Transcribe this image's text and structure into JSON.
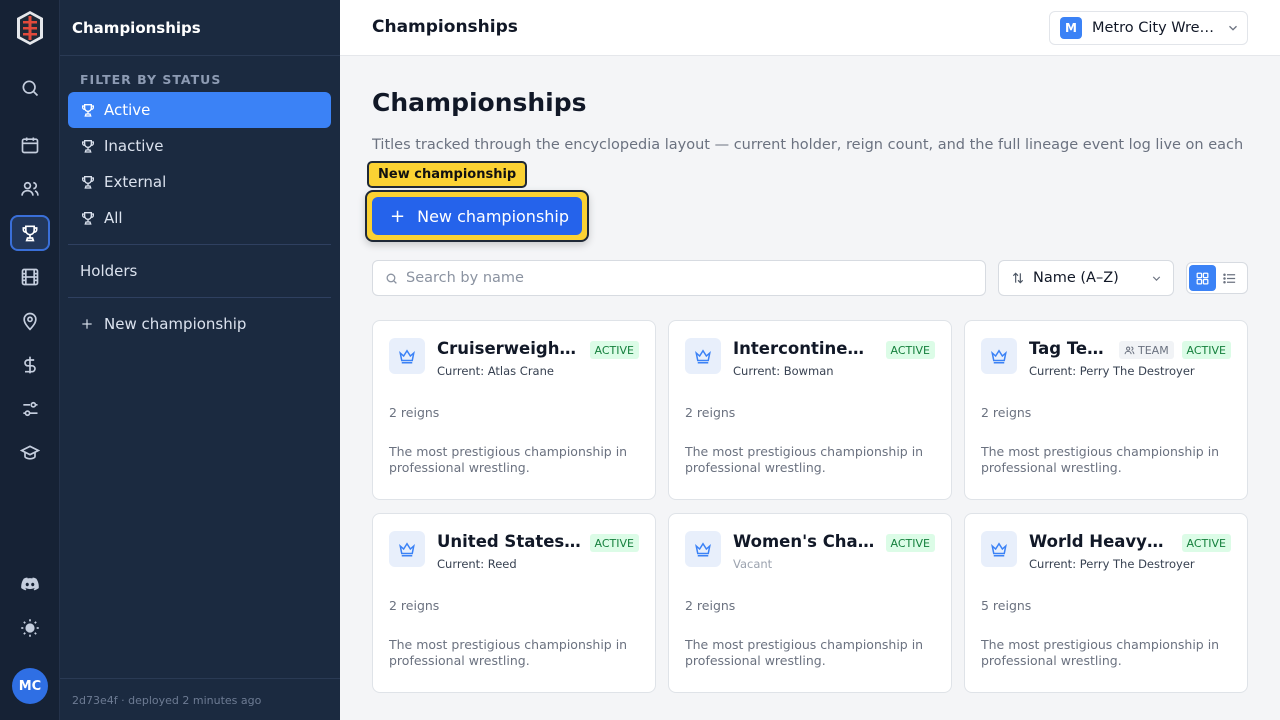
{
  "sidebar": {
    "title": "Championships",
    "filter_label": "FILTER BY STATUS",
    "filters": [
      {
        "label": "Active",
        "active": true
      },
      {
        "label": "Inactive",
        "active": false
      },
      {
        "label": "External",
        "active": false
      },
      {
        "label": "All",
        "active": false
      }
    ],
    "holders_label": "Holders",
    "new_label": "New championship",
    "deploy_hash": "2d73e4f",
    "deploy_text": "· deployed 2 minutes ago"
  },
  "rail": {
    "icons": [
      "search-icon",
      "calendar-icon",
      "users-icon",
      "trophy-icon",
      "film-icon",
      "map-pin-icon",
      "dollar-icon",
      "sliders-icon",
      "graduation-cap-icon",
      "discord-icon",
      "sun-icon"
    ],
    "active_icon": "trophy-icon",
    "avatar_initials": "MC"
  },
  "topbar": {
    "title": "Championships",
    "org_initial": "M",
    "org_name": "Metro City Wrestling"
  },
  "main": {
    "title": "Championships",
    "description": "Titles tracked through the encyclopedia layout — current holder, reign count, and the full lineage event log live on each",
    "tooltip": "New championship",
    "new_button_label": "New championship",
    "search_placeholder": "Search by name",
    "sort_label": "Name (A–Z)"
  },
  "cards": [
    {
      "name": "Cruiserweight Championship",
      "status": "ACTIVE",
      "team": false,
      "current": "Current: Atlas Crane",
      "vacant": false,
      "reigns": "2 reigns",
      "description": "The most prestigious championship in professional wrestling."
    },
    {
      "name": "Intercontinental Championship",
      "status": "ACTIVE",
      "team": false,
      "current": "Current: Bowman",
      "vacant": false,
      "reigns": "2 reigns",
      "description": "The most prestigious championship in professional wrestling."
    },
    {
      "name": "Tag Team Championship",
      "status": "ACTIVE",
      "team": true,
      "team_label": "TEAM",
      "current": "Current: Perry The Destroyer",
      "vacant": false,
      "reigns": "2 reigns",
      "description": "The most prestigious championship in professional wrestling."
    },
    {
      "name": "United States Championship",
      "status": "ACTIVE",
      "team": false,
      "current": "Current: Reed",
      "vacant": false,
      "reigns": "2 reigns",
      "description": "The most prestigious championship in professional wrestling."
    },
    {
      "name": "Women's Championship",
      "status": "ACTIVE",
      "team": false,
      "current": "Vacant",
      "vacant": true,
      "reigns": "2 reigns",
      "description": "The most prestigious championship in professional wrestling."
    },
    {
      "name": "World Heavyweight Championship",
      "status": "ACTIVE",
      "team": false,
      "current": "Current: Perry The Destroyer",
      "vacant": false,
      "reigns": "5 reigns",
      "description": "The most prestigious championship in professional wrestling."
    }
  ],
  "colors": {
    "accent": "#3b82f6",
    "rail_bg": "#162235",
    "panel_bg": "#1b2a40",
    "tooltip_bg": "#fbd233",
    "active_badge_bg": "#dcfce7",
    "active_badge_text": "#15803d"
  }
}
